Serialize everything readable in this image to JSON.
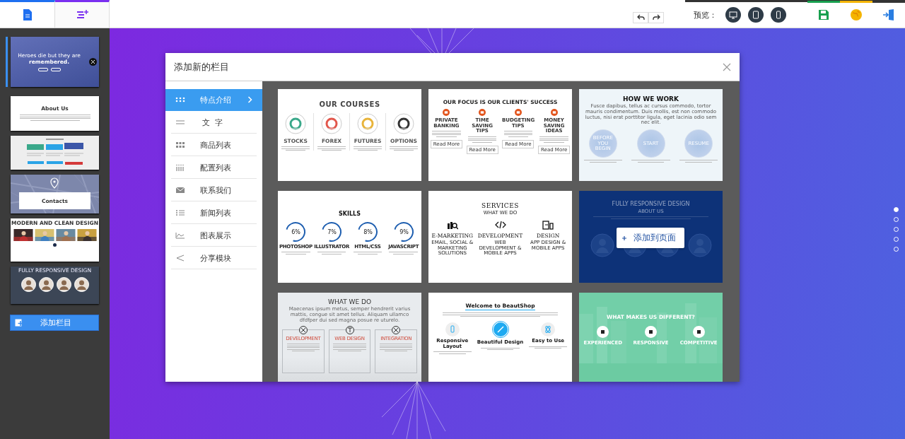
{
  "toolbar": {
    "preview_label": "预览："
  },
  "sidebar": {
    "pages": [
      {
        "kind": "hero",
        "text": "Heroes die but they are **remembered.**",
        "selected": true
      },
      {
        "kind": "about",
        "text": "About Us",
        "selected": false
      },
      {
        "kind": "pricing",
        "selected": false
      },
      {
        "kind": "map",
        "text": "Contacts",
        "selected": false
      },
      {
        "kind": "gallery",
        "text": "MODERN AND CLEAN DESIGN",
        "selected": false
      },
      {
        "kind": "team",
        "text": "FULLY RESPONSIVE DESIGN",
        "selected": false
      }
    ],
    "add_button": "添加栏目"
  },
  "dialog": {
    "title": "添加新的栏目",
    "categories": [
      {
        "label": "特点介绍",
        "selected": true
      },
      {
        "label": "文  字",
        "selected": false
      },
      {
        "label": "商品列表",
        "selected": false
      },
      {
        "label": "配置列表",
        "selected": false
      },
      {
        "label": "联系我们",
        "selected": false
      },
      {
        "label": "新闻列表",
        "selected": false
      },
      {
        "label": "图表展示",
        "selected": false
      },
      {
        "label": "分享模块",
        "selected": false
      }
    ],
    "templates": [
      {
        "kind": "courses",
        "title": "OUR COURSES",
        "items": [
          {
            "label": "STOCKS"
          },
          {
            "label": "FOREX"
          },
          {
            "label": "FUTURES"
          },
          {
            "label": "OPTIONS"
          }
        ]
      },
      {
        "kind": "focus",
        "title": "OUR FOCUS IS OUR CLIENTS' SUCCESS",
        "items": [
          {
            "label": "PRIVATE BANKING",
            "button": "Read More"
          },
          {
            "label": "TIME SAVING TIPS",
            "button": "Read More"
          },
          {
            "label": "BUDGETING TIPS",
            "button": "Read More"
          },
          {
            "label": "MONEY SAVING IDEAS",
            "button": "Read More"
          }
        ]
      },
      {
        "kind": "steps",
        "title": "HOW WE WORK",
        "intro": "Fusce dapibus, tellus ac cursus commodo, tortor mauris condimentum. Duis mollis, est non commodo luctus, nisi erat porttitor ligula, eget lacinia odio sem nec elit.",
        "items": [
          {
            "label": "BEFORE YOU BEGIN"
          },
          {
            "label": "START"
          },
          {
            "label": "RESUME"
          }
        ]
      },
      {
        "kind": "skills",
        "title": "SKILLS",
        "items": [
          {
            "label": "PHOTOSHOP",
            "value": "6%"
          },
          {
            "label": "ILLUSTRATOR",
            "value": "7%"
          },
          {
            "label": "HTML/CSS",
            "value": "8%"
          },
          {
            "label": "JAVASCRIPT",
            "value": "9%"
          }
        ]
      },
      {
        "kind": "services",
        "title": "SERVICES",
        "subtitle": "WHAT WE DO",
        "items": [
          {
            "label": "E-MARKETING",
            "sub": "EMAIL, SOCIAL & MARKETING SOLUTIONS"
          },
          {
            "label": "DEVELOPMENT",
            "sub": "WEB DEVELOPMENT & MOBILE APPS"
          },
          {
            "label": "DESIGN",
            "sub": "APP DESIGN & MOBILE APPS"
          }
        ]
      },
      {
        "kind": "team",
        "title": "FULLY RESPONSIVE DESIGN",
        "subtitle": "ABOUT US",
        "hovered": true,
        "overlay_button": "添加到页面"
      },
      {
        "kind": "features",
        "title": "WHAT WE DO",
        "intro": "Maecenas ipsum metus, semper hendrerit varius mattis, congue sit amet tellus. Aliquam ullamco dfdfper dui sed magna posue re uturelo.",
        "items": [
          {
            "label": "DEVELOPMENT"
          },
          {
            "label": "WEB DESIGN"
          },
          {
            "label": "INTEGRATION"
          }
        ]
      },
      {
        "kind": "welcome",
        "title": "Welcome to BeautShop",
        "items": [
          {
            "label": "Responsive Layout",
            "highlighted": false
          },
          {
            "label": "Beautiful Design",
            "highlighted": true
          },
          {
            "label": "Easy to Use",
            "highlighted": false
          }
        ]
      },
      {
        "kind": "different",
        "title": "WHAT MAKES US DIFFERENT?",
        "items": [
          {
            "label": "EXPERIENCED"
          },
          {
            "label": "RESPONSIVE"
          },
          {
            "label": "COMPETITIVE"
          }
        ]
      }
    ]
  },
  "page_dots": [
    {
      "selected": true
    },
    {
      "selected": false
    },
    {
      "selected": false
    },
    {
      "selected": false
    },
    {
      "selected": false
    }
  ]
}
